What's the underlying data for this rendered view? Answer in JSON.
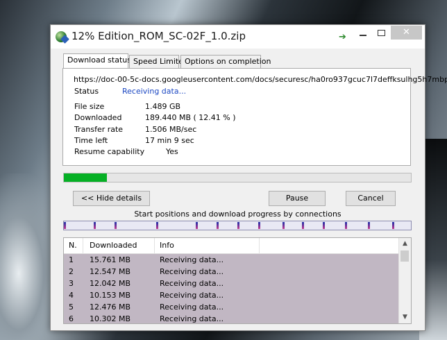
{
  "window": {
    "title": "12% Edition_ROM_SC-02F_1.0.zip",
    "close_glyph": "✕",
    "arrow_glyph": "➔"
  },
  "tabs": [
    {
      "label": "Download status"
    },
    {
      "label": "Speed Limiter"
    },
    {
      "label": "Options on completion"
    }
  ],
  "status": {
    "url": "https://doc-00-5c-docs.googleusercontent.com/docs/securesc/ha0ro937gcuc7l7deffksulhg5h7mbp",
    "status_label": "Status",
    "status_value": "Receiving data...",
    "file_size_label": "File size",
    "file_size_value": "1.489  GB",
    "downloaded_label": "Downloaded",
    "downloaded_value": "189.440  MB  ( 12.41 % )",
    "transfer_rate_label": "Transfer rate",
    "transfer_rate_value": "1.506  MB/sec",
    "time_left_label": "Time left",
    "time_left_value": "17 min 9 sec",
    "resume_label": "Resume capability",
    "resume_value": "Yes"
  },
  "progress": {
    "percent": 12.41,
    "color": "#06b025"
  },
  "buttons": {
    "hide_details": "<< Hide details",
    "pause": "Pause",
    "cancel": "Cancel"
  },
  "connections": {
    "title": "Start positions and download progress by connections",
    "markers": [
      0.0,
      0.085,
      0.145,
      0.265,
      0.38,
      0.44,
      0.5,
      0.56,
      0.63,
      0.685,
      0.745,
      0.81,
      0.875,
      0.945
    ]
  },
  "table": {
    "columns": [
      "N.",
      "Downloaded",
      "Info"
    ],
    "rows": [
      {
        "n": "1",
        "downloaded": "15.761  MB",
        "info": "Receiving data..."
      },
      {
        "n": "2",
        "downloaded": "12.547  MB",
        "info": "Receiving data..."
      },
      {
        "n": "3",
        "downloaded": "12.042  MB",
        "info": "Receiving data..."
      },
      {
        "n": "4",
        "downloaded": "10.153  MB",
        "info": "Receiving data..."
      },
      {
        "n": "5",
        "downloaded": "12.476  MB",
        "info": "Receiving data..."
      },
      {
        "n": "6",
        "downloaded": "10.302  MB",
        "info": "Receiving data..."
      }
    ]
  }
}
